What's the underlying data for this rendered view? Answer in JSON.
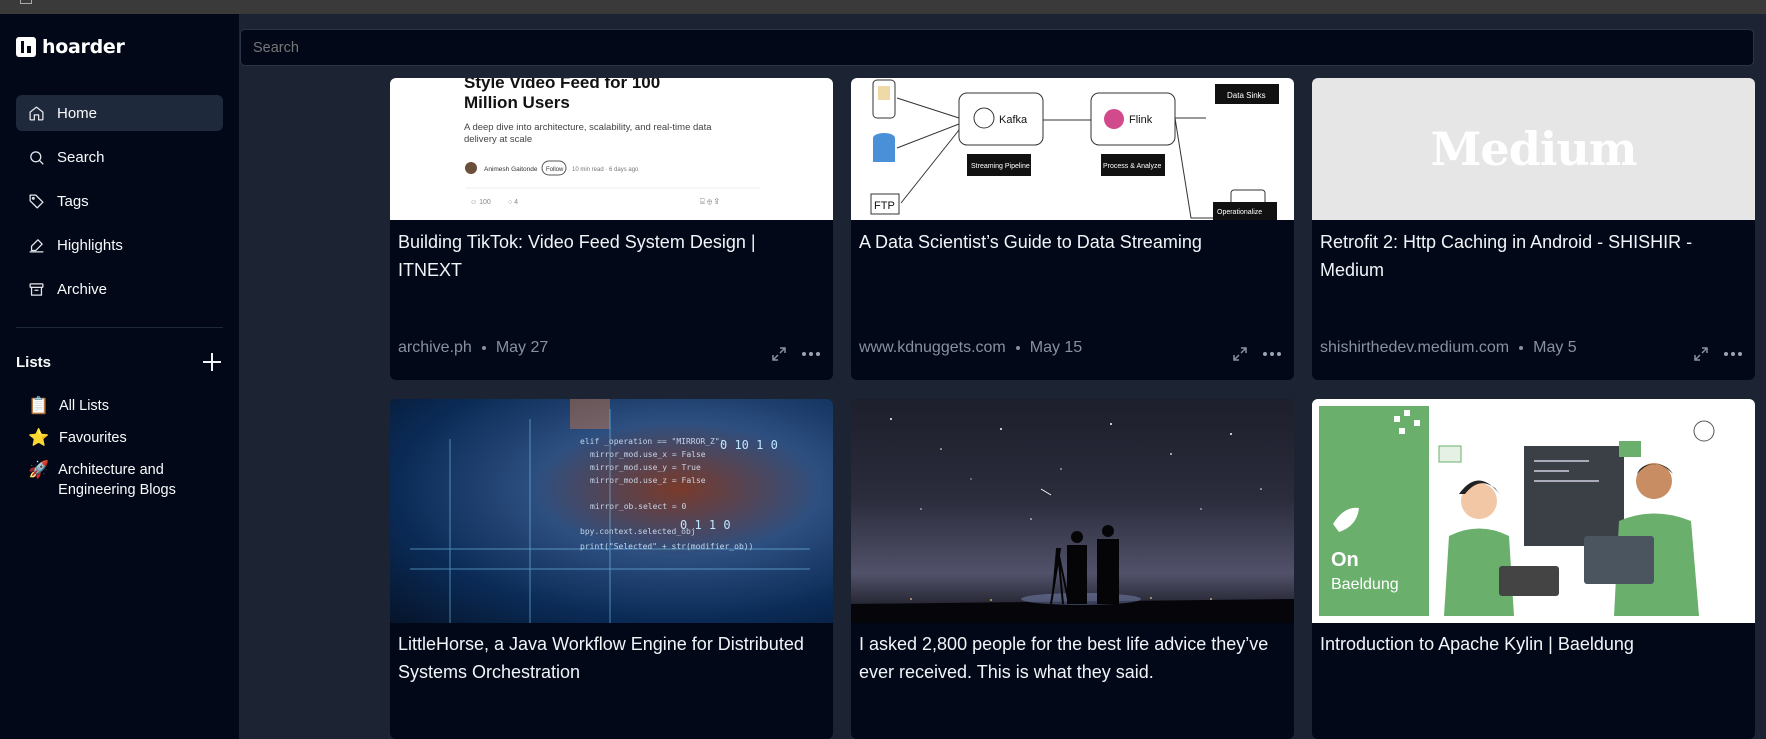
{
  "app": {
    "name": "hoarder"
  },
  "search": {
    "placeholder": "Search"
  },
  "nav": [
    {
      "label": "Home",
      "icon": "home-icon",
      "active": true
    },
    {
      "label": "Search",
      "icon": "search-icon"
    },
    {
      "label": "Tags",
      "icon": "tag-icon"
    },
    {
      "label": "Highlights",
      "icon": "highlighter-icon"
    },
    {
      "label": "Archive",
      "icon": "archive-icon"
    }
  ],
  "lists": {
    "title": "Lists",
    "items": [
      {
        "emoji": "📋",
        "label": "All Lists"
      },
      {
        "emoji": "⭐",
        "label": "Favourites"
      },
      {
        "emoji": "🚀",
        "label": "Architecture and Engineering Blogs"
      }
    ]
  },
  "cards": [
    {
      "title": "Building TikTok: Video Feed System Design | ITNEXT",
      "source": "archive.ph",
      "date": "May 27",
      "thumb": {
        "headline": "Style Video Feed for 100 Million Users",
        "subtitle": "A deep dive into architecture, scalability, and real-time data delivery at scale",
        "author": "Animesh Gaitonde",
        "follow": "Follow",
        "read": "10 min read · 6 days ago"
      }
    },
    {
      "title": "A Data Scientist’s Guide to Data Streaming",
      "source": "www.kdnuggets.com",
      "date": "May 15",
      "thumb": {
        "kafka": "Kafka",
        "flink": "Flink",
        "streaming": "Streaming Pipeline",
        "process": "Process & Analyze",
        "sinks": "Data Sinks",
        "operationalize": "Operationalize",
        "ftp": "FTP"
      }
    },
    {
      "title": "Retrofit 2: Http Caching in Android - SHISHIR - Medium",
      "source": "shishirthedev.medium.com",
      "date": "May 5",
      "thumb": {
        "logo": "Medium"
      }
    },
    {
      "title": "LittleHorse, a Java Workflow Engine for Distributed Systems Orchestration"
    },
    {
      "title": "I asked 2,800 people for the best life advice they’ve ever received. This is what they said."
    },
    {
      "title": "Introduction to Apache Kylin | Baeldung",
      "thumb": {
        "on": "On",
        "baeldung": "Baeldung"
      }
    }
  ],
  "colors": {
    "sidebar": "#020817",
    "main": "#1c2433",
    "card": "#020817",
    "muted": "#8791a0"
  }
}
